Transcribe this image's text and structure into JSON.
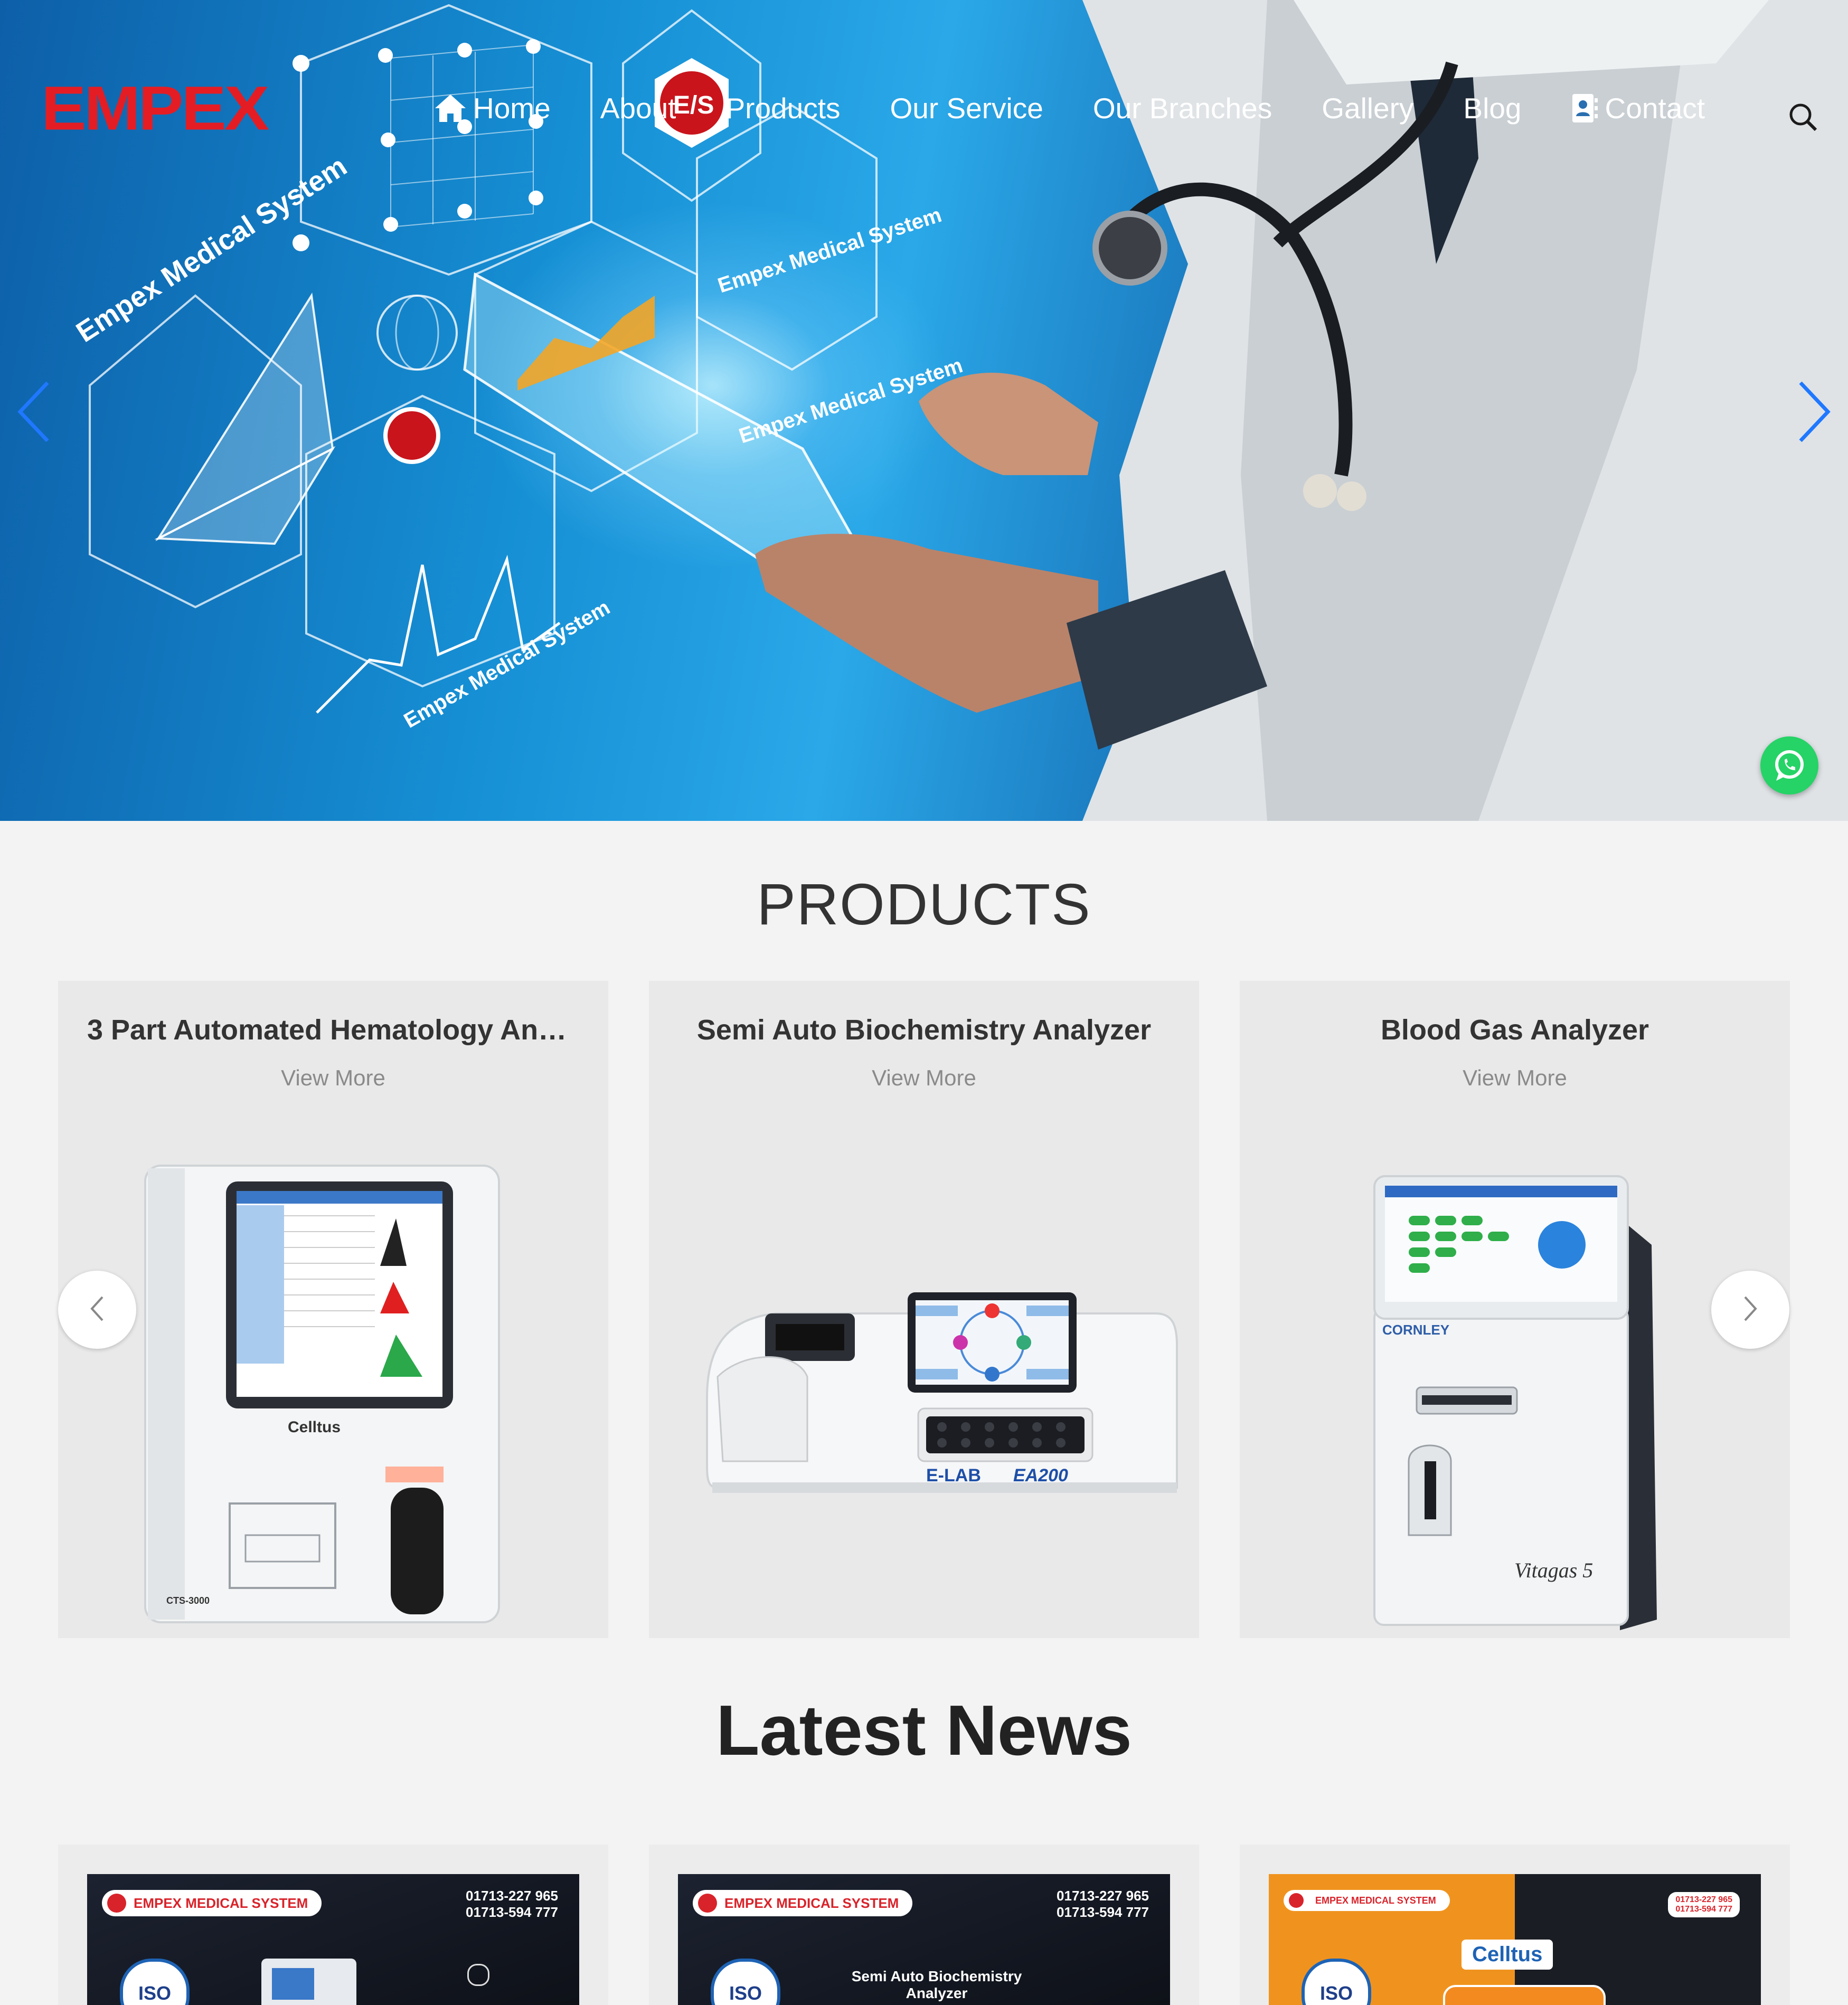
{
  "brand": {
    "logo_text": "EMPEX",
    "logo_color": "#e41d24"
  },
  "nav": {
    "items": [
      {
        "label": "Home",
        "icon": "home-icon"
      },
      {
        "label": "About"
      },
      {
        "label": "Products"
      },
      {
        "label": "Our Service"
      },
      {
        "label": "Our Branches"
      },
      {
        "label": "Gallery"
      },
      {
        "label": "Blog"
      },
      {
        "label": "Contact",
        "icon": "contact-card-icon"
      }
    ],
    "search_icon": "search-icon"
  },
  "hero": {
    "overlay_texts": [
      "Empex Medical System",
      "Empex Medical System",
      "Empex Medical System",
      "Empex Medical System"
    ],
    "badge_text": "E/S",
    "prev_icon": "chevron-left-icon",
    "next_icon": "chevron-right-icon",
    "whatsapp_icon": "whatsapp-icon",
    "whatsapp_color": "#25d366"
  },
  "products": {
    "title": "PRODUCTS",
    "cards": [
      {
        "title": "3 Part Automated Hematology An…",
        "more": "View More",
        "device_label": "Celltus",
        "model": "CTS-3000"
      },
      {
        "title": "Semi Auto Biochemistry Analyzer",
        "more": "View More",
        "device_label": "E-LAB",
        "model": "EA200"
      },
      {
        "title": "Blood Gas Analyzer",
        "more": "View More",
        "device_label": "CORNLEY",
        "model": "Vitagas 5"
      }
    ],
    "prev_icon": "chevron-left-icon",
    "next_icon": "chevron-right-icon"
  },
  "news": {
    "title": "Latest News",
    "cards": [
      {
        "brand": "EMPEX MEDICAL SYSTEM",
        "phone1": "01713-227 965",
        "phone2": "01713-594 777",
        "caption": "",
        "iso": "ISO"
      },
      {
        "brand": "EMPEX MEDICAL SYSTEM",
        "phone1": "01713-227 965",
        "phone2": "01713-594 777",
        "caption": "Semi Auto Biochemistry Analyzer",
        "iso": "ISO"
      },
      {
        "brand": "EMPEX MEDICAL SYSTEM",
        "phone1": "01713-227 965",
        "phone2": "01713-594 777",
        "caption": "",
        "tag": "Celltus",
        "iso": "ISO"
      }
    ]
  }
}
